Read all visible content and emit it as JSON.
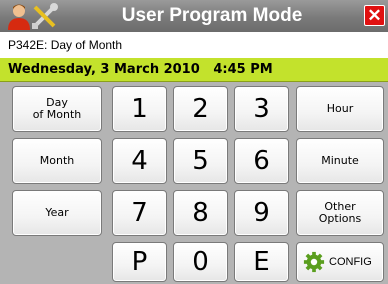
{
  "window": {
    "title": "User Program Mode",
    "close_label": "✕"
  },
  "param": {
    "label": "P342E: Day of Month"
  },
  "datetime": {
    "text": "Wednesday, 3 March 2010   4:45 PM"
  },
  "left_buttons": [
    {
      "name": "day-of-month-button",
      "label": "Day\nof Month"
    },
    {
      "name": "month-button",
      "label": "Month"
    },
    {
      "name": "year-button",
      "label": "Year"
    }
  ],
  "keypad": [
    {
      "name": "key-1",
      "label": "1"
    },
    {
      "name": "key-2",
      "label": "2"
    },
    {
      "name": "key-3",
      "label": "3"
    },
    {
      "name": "key-4",
      "label": "4"
    },
    {
      "name": "key-5",
      "label": "5"
    },
    {
      "name": "key-6",
      "label": "6"
    },
    {
      "name": "key-7",
      "label": "7"
    },
    {
      "name": "key-8",
      "label": "8"
    },
    {
      "name": "key-9",
      "label": "9"
    },
    {
      "name": "key-p",
      "label": "P"
    },
    {
      "name": "key-0",
      "label": "0"
    },
    {
      "name": "key-e",
      "label": "E"
    }
  ],
  "right_buttons": [
    {
      "name": "hour-button",
      "label": "Hour"
    },
    {
      "name": "minute-button",
      "label": "Minute"
    },
    {
      "name": "other-options-button",
      "label": "Other\nOptions"
    }
  ],
  "config": {
    "label": "CONFIG",
    "icon": "gear-icon",
    "icon_color": "#5a9e1e"
  },
  "colors": {
    "date_bar": "#c3e22c",
    "close": "#e01010",
    "background": "#b4b4b4"
  }
}
